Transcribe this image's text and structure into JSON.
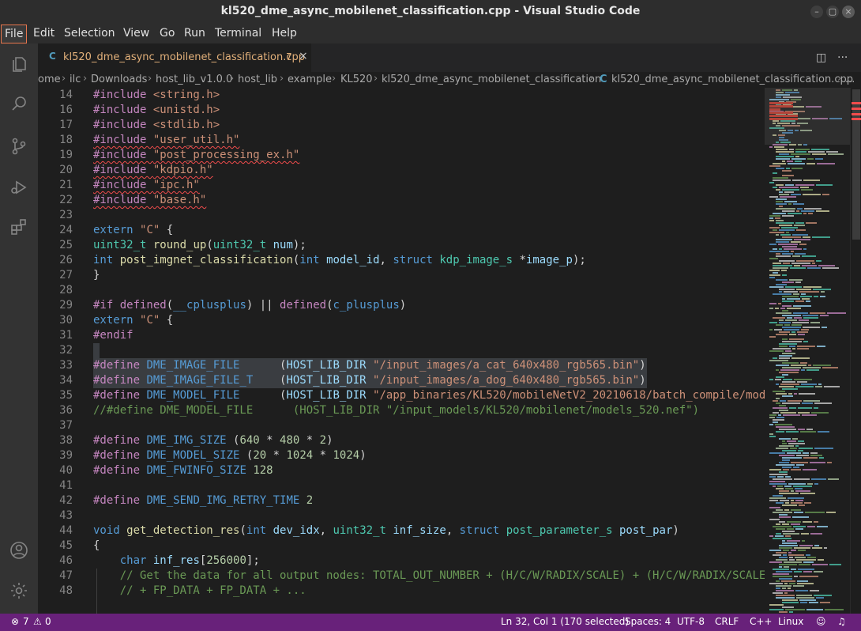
{
  "window": {
    "title": "kl520_dme_async_mobilenet_classification.cpp - Visual Studio Code",
    "controls": {
      "minimize": "–",
      "maximize": "▢",
      "close": "×"
    }
  },
  "menu": [
    "File",
    "Edit",
    "Selection",
    "View",
    "Go",
    "Run",
    "Terminal",
    "Help"
  ],
  "activity_bar": [
    "explorer-icon",
    "search-icon",
    "source-control-icon",
    "run-debug-icon",
    "extensions-icon",
    "account-icon",
    "manage-gear-icon"
  ],
  "tab": {
    "language_icon": "C",
    "filename": "kl520_dme_async_mobilenet_classification.cpp",
    "problems": "7",
    "close": "×",
    "split_icon": "◫",
    "more_icon": "···"
  },
  "breadcrumb": [
    "ome",
    "ilc",
    "Downloads",
    "host_lib_v1.0.0",
    "host_lib",
    "example",
    "KL520",
    "kl520_dme_async_mobilenet_classification",
    "kl520_dme_async_mobilenet_classification.cpp",
    "..."
  ],
  "breadcrumb_file_icon": "C",
  "code_lines": [
    {
      "n": "14",
      "t": [
        [
          "#include ",
          "pp"
        ],
        [
          "<string.h>",
          "str"
        ]
      ]
    },
    {
      "n": "16",
      "t": [
        [
          "#include ",
          "pp"
        ],
        [
          "<unistd.h>",
          "str"
        ]
      ]
    },
    {
      "n": "17",
      "t": [
        [
          "#include ",
          "pp"
        ],
        [
          "<stdlib.h>",
          "str"
        ]
      ]
    },
    {
      "n": "18",
      "t": [
        [
          "#include \"user_util.h\"",
          "pp_sq"
        ]
      ]
    },
    {
      "n": "19",
      "t": [
        [
          "#include \"post_processing_ex.h\"",
          "pp_sq"
        ]
      ]
    },
    {
      "n": "20",
      "t": [
        [
          "#include \"kdpio.h\"",
          "pp_sq"
        ]
      ]
    },
    {
      "n": "21",
      "t": [
        [
          "#include \"ipc.h\"",
          "pp_sq"
        ]
      ]
    },
    {
      "n": "22",
      "t": [
        [
          "#include \"base.h\"",
          "pp_sq"
        ]
      ]
    },
    {
      "n": "23",
      "t": []
    },
    {
      "n": "24",
      "t": [
        [
          "extern ",
          "kw"
        ],
        [
          "\"C\"",
          "str"
        ],
        [
          " {",
          "def"
        ]
      ]
    },
    {
      "n": "25",
      "t": [
        [
          "uint32_t",
          "ty"
        ],
        [
          " ",
          "def"
        ],
        [
          "round_up",
          "fn"
        ],
        [
          "(",
          "def"
        ],
        [
          "uint32_t",
          "ty"
        ],
        [
          " ",
          "def"
        ],
        [
          "num",
          "var"
        ],
        [
          ");",
          "def"
        ]
      ]
    },
    {
      "n": "26",
      "t": [
        [
          "int",
          "kw"
        ],
        [
          " ",
          "def"
        ],
        [
          "post_imgnet_classification",
          "fn"
        ],
        [
          "(",
          "def"
        ],
        [
          "int",
          "kw"
        ],
        [
          " ",
          "def"
        ],
        [
          "model_id",
          "var"
        ],
        [
          ", ",
          "def"
        ],
        [
          "struct",
          "kw"
        ],
        [
          " ",
          "def"
        ],
        [
          "kdp_image_s",
          "ty"
        ],
        [
          " *",
          "def"
        ],
        [
          "image_p",
          "var"
        ],
        [
          ");",
          "def"
        ]
      ]
    },
    {
      "n": "27",
      "t": [
        [
          "}",
          "def"
        ]
      ]
    },
    {
      "n": "28",
      "t": []
    },
    {
      "n": "29",
      "t": [
        [
          "#if ",
          "pp"
        ],
        [
          "defined",
          "pp"
        ],
        [
          "(",
          "def"
        ],
        [
          "__cplusplus",
          "mac"
        ],
        [
          ") || ",
          "def"
        ],
        [
          "defined",
          "pp"
        ],
        [
          "(",
          "def"
        ],
        [
          "c_plusplus",
          "mac"
        ],
        [
          ")",
          "def"
        ]
      ]
    },
    {
      "n": "30",
      "t": [
        [
          "extern ",
          "kw"
        ],
        [
          "\"C\"",
          "str"
        ],
        [
          " {",
          "def"
        ]
      ]
    },
    {
      "n": "31",
      "t": [
        [
          "#endif",
          "pp"
        ]
      ]
    },
    {
      "n": "32",
      "t": []
    },
    {
      "n": "33",
      "t": [
        [
          "#define ",
          "pp"
        ],
        [
          "DME_IMAGE_FILE",
          "mac"
        ],
        [
          "      ",
          "def"
        ],
        [
          "(",
          "def"
        ],
        [
          "HOST_LIB_DIR",
          "var"
        ],
        [
          " ",
          "def"
        ],
        [
          "\"/input_images/a_cat_640x480_rgb565.bin\"",
          "str"
        ],
        [
          ")",
          "def"
        ]
      ]
    },
    {
      "n": "34",
      "t": [
        [
          "#define ",
          "pp"
        ],
        [
          "DME_IMAGE_FILE_T",
          "mac"
        ],
        [
          "    ",
          "def"
        ],
        [
          "(",
          "def"
        ],
        [
          "HOST_LIB_DIR",
          "var"
        ],
        [
          " ",
          "def"
        ],
        [
          "\"/input_images/a_dog_640x480_rgb565.bin\"",
          "str"
        ],
        [
          ")",
          "def"
        ]
      ]
    },
    {
      "n": "35",
      "t": [
        [
          "#define ",
          "pp"
        ],
        [
          "DME_MODEL_FILE",
          "mac"
        ],
        [
          "      ",
          "def"
        ],
        [
          "(",
          "def"
        ],
        [
          "HOST_LIB_DIR",
          "var"
        ],
        [
          " ",
          "def"
        ],
        [
          "\"/app_binaries/KL520/mobileNetV2_20210618/batch_compile/mod",
          "str"
        ]
      ]
    },
    {
      "n": "36",
      "t": [
        [
          "//#define DME_MODEL_FILE      (HOST_LIB_DIR \"/input_models/KL520/mobilenet/models_520.nef\")",
          "cmt"
        ]
      ]
    },
    {
      "n": "37",
      "t": []
    },
    {
      "n": "38",
      "t": [
        [
          "#define ",
          "pp"
        ],
        [
          "DME_IMG_SIZE",
          "mac"
        ],
        [
          " (",
          "def"
        ],
        [
          "640",
          "num"
        ],
        [
          " * ",
          "def"
        ],
        [
          "480",
          "num"
        ],
        [
          " * ",
          "def"
        ],
        [
          "2",
          "num"
        ],
        [
          ")",
          "def"
        ]
      ]
    },
    {
      "n": "39",
      "t": [
        [
          "#define ",
          "pp"
        ],
        [
          "DME_MODEL_SIZE",
          "mac"
        ],
        [
          " (",
          "def"
        ],
        [
          "20",
          "num"
        ],
        [
          " * ",
          "def"
        ],
        [
          "1024",
          "num"
        ],
        [
          " * ",
          "def"
        ],
        [
          "1024",
          "num"
        ],
        [
          ")",
          "def"
        ]
      ]
    },
    {
      "n": "40",
      "t": [
        [
          "#define ",
          "pp"
        ],
        [
          "DME_FWINFO_SIZE",
          "mac"
        ],
        [
          " ",
          "def"
        ],
        [
          "128",
          "num"
        ]
      ]
    },
    {
      "n": "41",
      "t": []
    },
    {
      "n": "42",
      "t": [
        [
          "#define ",
          "pp"
        ],
        [
          "DME_SEND_IMG_RETRY_TIME",
          "mac"
        ],
        [
          " ",
          "def"
        ],
        [
          "2",
          "num"
        ]
      ]
    },
    {
      "n": "43",
      "t": []
    },
    {
      "n": "44",
      "t": [
        [
          "void",
          "kw"
        ],
        [
          " ",
          "def"
        ],
        [
          "get_detection_res",
          "fn"
        ],
        [
          "(",
          "def"
        ],
        [
          "int",
          "kw"
        ],
        [
          " ",
          "def"
        ],
        [
          "dev_idx",
          "var"
        ],
        [
          ", ",
          "def"
        ],
        [
          "uint32_t",
          "ty"
        ],
        [
          " ",
          "def"
        ],
        [
          "inf_size",
          "var"
        ],
        [
          ", ",
          "def"
        ],
        [
          "struct",
          "kw"
        ],
        [
          " ",
          "def"
        ],
        [
          "post_parameter_s",
          "ty"
        ],
        [
          " ",
          "def"
        ],
        [
          "post_par",
          "var"
        ],
        [
          ")",
          "def"
        ]
      ]
    },
    {
      "n": "45",
      "t": [
        [
          "{",
          "def"
        ]
      ]
    },
    {
      "n": "46",
      "t": [
        [
          "    ",
          "def"
        ],
        [
          "char",
          "kw"
        ],
        [
          " ",
          "def"
        ],
        [
          "inf_res",
          "var"
        ],
        [
          "[",
          "def"
        ],
        [
          "256000",
          "num"
        ],
        [
          "];",
          "def"
        ]
      ]
    },
    {
      "n": "47",
      "t": [
        [
          "    // Get the data for all output nodes: TOTAL_OUT_NUMBER + (H/C/W/RADIX/SCALE) + (H/C/W/RADIX/SCALE",
          "cmt"
        ]
      ]
    },
    {
      "n": "48",
      "t": [
        [
          "    // + FP_DATA + FP_DATA + ...",
          "cmt"
        ]
      ]
    }
  ],
  "status": {
    "errors": "7",
    "warnings": "0",
    "position": "Ln 32, Col 1 (170 selected)",
    "spaces": "Spaces: 4",
    "encoding": "UTF-8",
    "eol": "CRLF",
    "language": "C++",
    "platform": "Linux"
  },
  "colors": {
    "statusbar": "#68217a",
    "accent": "#e8764d",
    "modified_tab": "#e2b07a"
  }
}
